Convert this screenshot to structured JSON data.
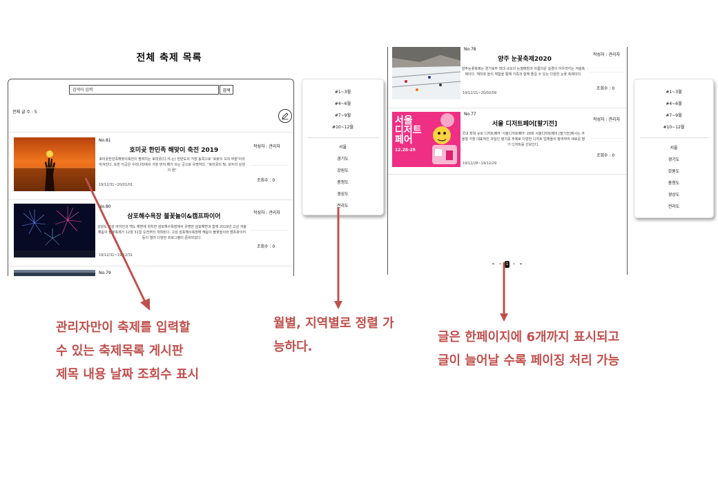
{
  "page_title": "전체 축제 목록",
  "left_board": {
    "search_placeholder": "검색어 입력",
    "search_button": "검색",
    "total_count": "전체 글 수 : 5",
    "posts": [
      {
        "no": "No.81",
        "title": "호미곶 한민족 해맞이 축전 2019",
        "desc": "호미곶한민족해맞이축전이 펼쳐지는 호미곶(다.석.는) 한반도의 가장 동쪽으로 '호랑이 꼬리 부분'이라 여겨진다. 또한 이곳은 우리나라에서 가장 먼저 해가 뜨는 곳으로 유명하다. \"호미곶의 빛, 모두의 상생의 꿈\"",
        "date": "19/12/31~20/01/01",
        "author": "작성자 : 관리자",
        "views": "조회수 : 0"
      },
      {
        "no": "No.80",
        "title": "삼포해수욕장 불꽃놀이&캠프파이어",
        "desc": "강원도 고성 아야진과 백도 해변에 위치한 삼포해수욕장에서 유명한 삼포해변과 함께 2019년 고성 겨울 해돋이 불꽃축제가 12월 31일 오전부터 개최된다. 고성 삼포해수욕장에 해돋이 불꽃놀이와 캠프파이어 등이 열려 다양한 프로그램이 준비되었다.",
        "date": "19/12/31~19/12/31",
        "author": "작성자 : 관리자",
        "views": "조회수 : 0"
      },
      {
        "no": "No.79"
      }
    ]
  },
  "sort_panel_1": {
    "months": [
      "#1~3월",
      "#4~6월",
      "#7~9월",
      "#10~12월"
    ],
    "regions": [
      "서울",
      "경기도",
      "강원도",
      "충청도",
      "경상도",
      "전라도"
    ]
  },
  "sort_panel_2": {
    "months": [
      "#1~3월",
      "#4~6월",
      "#7~9월",
      "#10~12월"
    ],
    "regions": [
      "서울",
      "경기도",
      "강원도",
      "충청도",
      "경상도",
      "전라도"
    ]
  },
  "right_board": {
    "posts": [
      {
        "no": "No.78",
        "title": "양주 눈꽃축제2020",
        "desc": "양주눈꽃축제는 경기북부 최대 규모의 눈썰매장과 아름다운 설경이 어우러지는 겨울축제이다. 재미와 놀이 체험을 통해 가족과 함께 즐길 수 있는 다양한 눈꽃 축제이다.",
        "date": "19/12/21~20/02/09",
        "author": "작성자 : 관리자",
        "views": "조회수 : 0"
      },
      {
        "no": "No.77",
        "title": "서울 디저트페어[팔기전]",
        "desc": "국내 최대 규모 디저트페어 '서울디저트페어' 28회 서울디저트페어 [딸기전]에서는 겨울철 가장 대표적인 과일인 딸기를 주제로 다양한 디저트 업체들이 참여하여 새로운 딸기 디저트를 선보인다.",
        "date": "19/12/28~19/12/29",
        "author": "작성자 : 관리자",
        "views": "조회수 : 0",
        "poster_text": [
          "서울",
          "디저트",
          "페어"
        ],
        "poster_date": "12.28-29"
      }
    ],
    "pager": [
      "«",
      "‹",
      "1",
      "›",
      "»"
    ]
  },
  "captions": {
    "left": [
      "관리자만이 축제를 입력할",
      "수 있는 축제목록 게시판",
      "제목 내용 날짜 조회수 표시"
    ],
    "middle": [
      "월별, 지역별로 정렬 가",
      "능하다."
    ],
    "right": [
      "글은 한페이지에 6개까지 표시되고",
      "글이 늘어날 수록 페이징 처리 가능"
    ]
  },
  "colors": {
    "caption": "#c0504d",
    "arrow": "#c0504d"
  }
}
